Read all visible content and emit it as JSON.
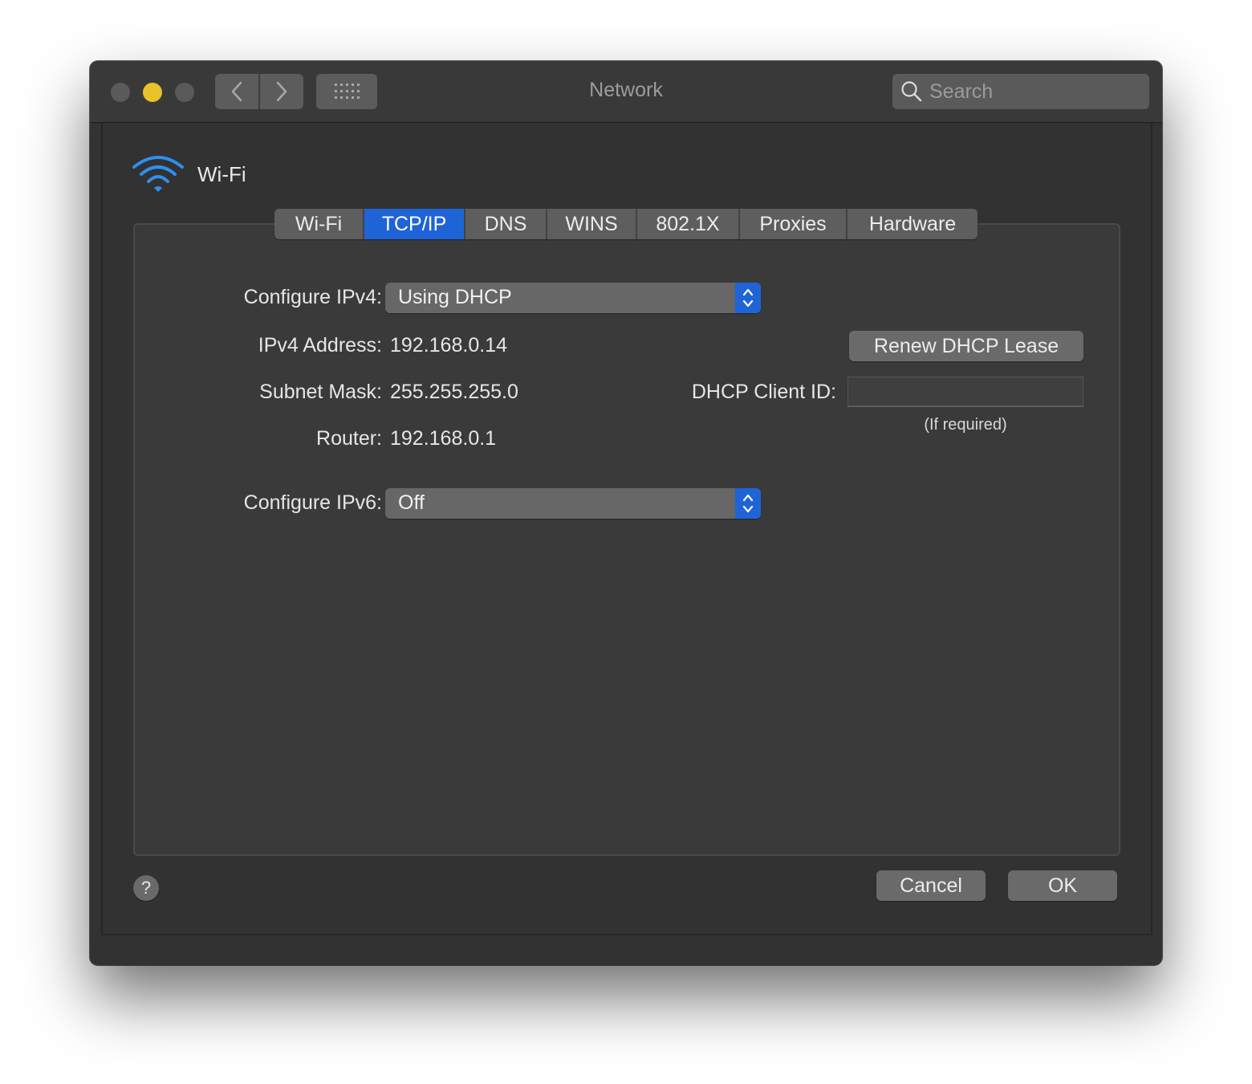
{
  "window": {
    "title": "Network",
    "search_placeholder": "Search"
  },
  "header": {
    "interface_name": "Wi-Fi",
    "icon": "wifi-icon"
  },
  "tabs": [
    {
      "label": "Wi-Fi",
      "active": false
    },
    {
      "label": "TCP/IP",
      "active": true
    },
    {
      "label": "DNS",
      "active": false
    },
    {
      "label": "WINS",
      "active": false
    },
    {
      "label": "802.1X",
      "active": false
    },
    {
      "label": "Proxies",
      "active": false
    },
    {
      "label": "Hardware",
      "active": false
    }
  ],
  "tcpip": {
    "configure_ipv4_label": "Configure IPv4:",
    "configure_ipv4_value": "Using DHCP",
    "ipv4_address_label": "IPv4 Address:",
    "ipv4_address_value": "192.168.0.14",
    "subnet_mask_label": "Subnet Mask:",
    "subnet_mask_value": "255.255.255.0",
    "router_label": "Router:",
    "router_value": "192.168.0.1",
    "configure_ipv6_label": "Configure IPv6:",
    "configure_ipv6_value": "Off",
    "renew_button": "Renew DHCP Lease",
    "dhcp_client_id_label": "DHCP Client ID:",
    "dhcp_client_id_value": "",
    "dhcp_client_id_hint": "(If required)"
  },
  "footer": {
    "help": "?",
    "cancel": "Cancel",
    "ok": "OK"
  },
  "colors": {
    "accent": "#1f64d6",
    "window_bg": "#323232",
    "minimize_button": "#e9c22b"
  }
}
